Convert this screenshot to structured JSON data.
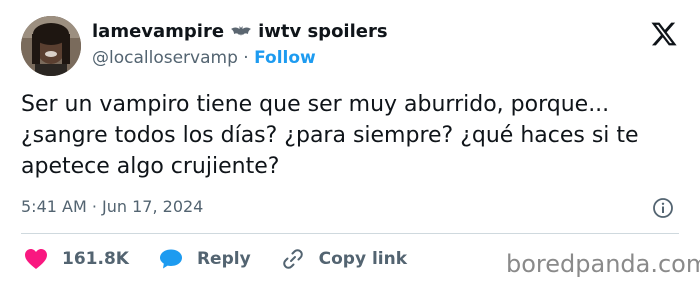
{
  "header": {
    "display_name": "lamevampire",
    "display_name_suffix": "iwtv spoilers",
    "handle": "@localloservamp",
    "separator": "·",
    "follow_label": "Follow"
  },
  "tweet": {
    "text": "Ser un vampiro tiene que ser muy aburrido, porque... ¿sangre todos los días? ¿para siempre? ¿qué haces si te apetece algo crujiente?",
    "timestamp": "5:41 AM · Jun 17, 2024"
  },
  "actions": {
    "likes": "161.8K",
    "reply_label": "Reply",
    "copy_link_label": "Copy link"
  },
  "watermark": "boredpanda.com",
  "colors": {
    "follow": "#1d9bf0",
    "heart": "#f91880",
    "reply_bubble": "#1d9bf0",
    "muted": "#536471"
  },
  "icons": [
    "bat-icon",
    "x-logo-icon",
    "info-icon",
    "heart-icon",
    "reply-icon",
    "link-icon"
  ]
}
